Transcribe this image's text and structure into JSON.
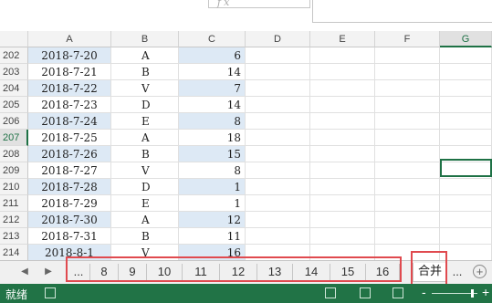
{
  "columns": [
    "A",
    "B",
    "C",
    "D",
    "E",
    "F",
    "G"
  ],
  "rows": [
    {
      "num": "202",
      "date": "2018-7-20",
      "code": "A",
      "value": "6",
      "hl": true
    },
    {
      "num": "203",
      "date": "2018-7-21",
      "code": "B",
      "value": "14",
      "hl": false
    },
    {
      "num": "204",
      "date": "2018-7-22",
      "code": "V",
      "value": "7",
      "hl": true
    },
    {
      "num": "205",
      "date": "2018-7-23",
      "code": "D",
      "value": "14",
      "hl": false
    },
    {
      "num": "206",
      "date": "2018-7-24",
      "code": "E",
      "value": "8",
      "hl": true
    },
    {
      "num": "207",
      "date": "2018-7-25",
      "code": "A",
      "value": "18",
      "hl": false
    },
    {
      "num": "208",
      "date": "2018-7-26",
      "code": "B",
      "value": "15",
      "hl": true
    },
    {
      "num": "209",
      "date": "2018-7-27",
      "code": "V",
      "value": "8",
      "hl": false
    },
    {
      "num": "210",
      "date": "2018-7-28",
      "code": "D",
      "value": "1",
      "hl": true
    },
    {
      "num": "211",
      "date": "2018-7-29",
      "code": "E",
      "value": "1",
      "hl": false
    },
    {
      "num": "212",
      "date": "2018-7-30",
      "code": "A",
      "value": "12",
      "hl": true
    },
    {
      "num": "213",
      "date": "2018-7-31",
      "code": "B",
      "value": "11",
      "hl": false
    },
    {
      "num": "214",
      "date": "2018-8-1",
      "code": "V",
      "value": "16",
      "hl": true
    }
  ],
  "selected_column": "G",
  "selected_row": "207",
  "formula_bar": {
    "fx_label": "fx"
  },
  "sheet_tabs": {
    "prev_icon": "triangle-left-icon",
    "next_icon": "triangle-right-icon",
    "left_ellipsis": "...",
    "tabs": [
      "8",
      "9",
      "10",
      "11",
      "12",
      "13",
      "14",
      "15",
      "16"
    ],
    "active_tab": "合并",
    "right_ellipsis": "...",
    "add_icon": "plus-circle-icon",
    "add_label": "+"
  },
  "status_bar": {
    "status": "就绪",
    "zoom_minus": "-",
    "zoom_plus": "+",
    "accent_color": "#217346"
  },
  "annotation_color": "#e04a4f"
}
